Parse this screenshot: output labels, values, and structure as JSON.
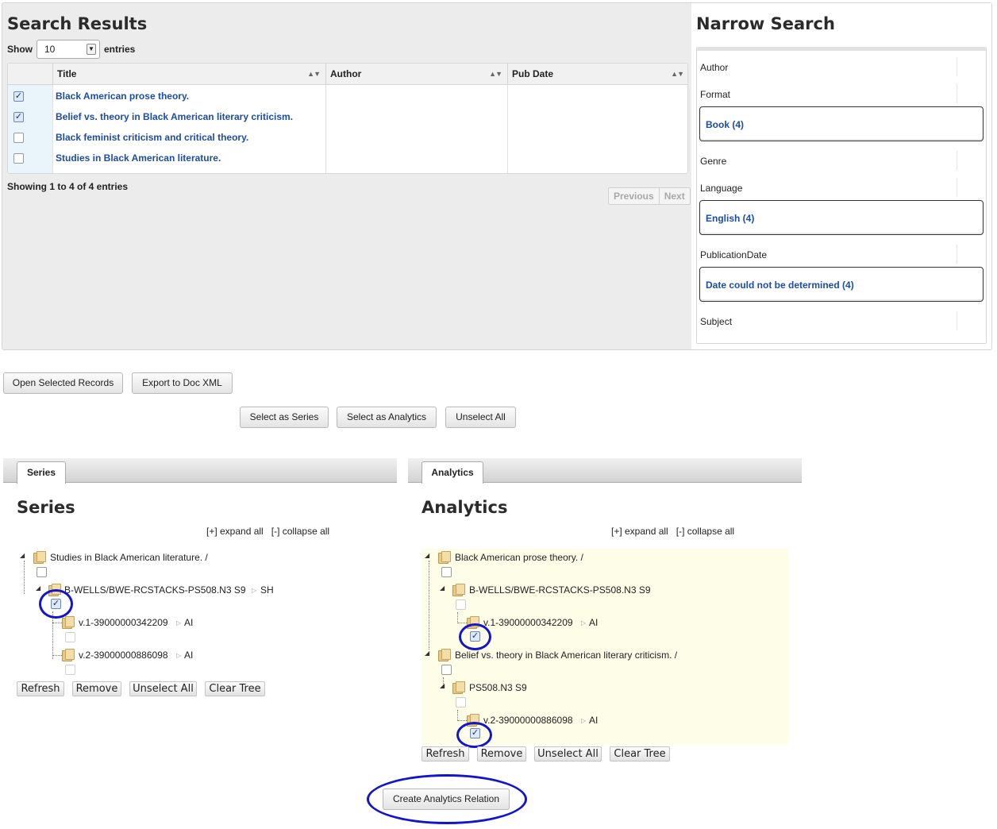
{
  "search_results": {
    "title": "Search Results",
    "show_label": "Show",
    "entries_value": "10",
    "entries_label": "entries",
    "columns": [
      "Title",
      "Author",
      "Pub Date"
    ],
    "rows": [
      {
        "title": "Black American prose theory.",
        "checked": true
      },
      {
        "title": "Belief vs. theory in Black American literary criticism.",
        "checked": true
      },
      {
        "title": "Black feminist criticism and critical theory.",
        "checked": false
      },
      {
        "title": "Studies in Black American literature.",
        "checked": false
      }
    ],
    "showing_text": "Showing 1 to 4 of 4 entries",
    "pager": {
      "previous": "Previous",
      "next": "Next"
    }
  },
  "narrow_search": {
    "title": "Narrow Search",
    "facets": {
      "author": "Author",
      "format": "Format",
      "format_value": "Book (4)",
      "genre": "Genre",
      "language": "Language",
      "language_value": "English (4)",
      "publication_date": "PublicationDate",
      "publication_date_value": "Date could not be determined (4)",
      "subject": "Subject"
    }
  },
  "actions": {
    "open_selected": "Open Selected Records",
    "export_doc_xml": "Export to Doc XML",
    "select_as_series": "Select as Series",
    "select_as_analytics": "Select as Analytics",
    "unselect_all": "Unselect All",
    "create_relation": "Create Analytics Relation"
  },
  "series_panel": {
    "tab": "Series",
    "title": "Series",
    "expand_all": "[+] expand all",
    "collapse_all": "[-] collapse all",
    "tree": {
      "root": "Studies in Black American literature. /",
      "holding": "B-WELLS/BWE-RCSTACKS-PS508.N3 S9",
      "holding_tag": "SH",
      "items": [
        {
          "label": "v.1-39000000342209",
          "tag": "AI"
        },
        {
          "label": "v.2-39000000886098",
          "tag": "AI"
        }
      ]
    },
    "buttons": {
      "refresh": "Refresh",
      "remove": "Remove",
      "unselect_all": "Unselect All",
      "clear_tree": "Clear Tree"
    }
  },
  "analytics_panel": {
    "tab": "Analytics",
    "title": "Analytics",
    "expand_all": "[+] expand all",
    "collapse_all": "[-] collapse all",
    "tree": {
      "root1": "Black American prose theory. /",
      "holding1": "B-WELLS/BWE-RCSTACKS-PS508.N3 S9",
      "item1": {
        "label": "v.1-39000000342209",
        "tag": "AI"
      },
      "root2": "Belief vs. theory in Black American literary criticism. /",
      "holding2": "PS508.N3 S9",
      "item2": {
        "label": "v.2-39000000886098",
        "tag": "AI"
      }
    },
    "buttons": {
      "refresh": "Refresh",
      "remove": "Remove",
      "unselect_all": "Unselect All",
      "clear_tree": "Clear Tree"
    }
  },
  "colors": {
    "link": "#1d4da0",
    "annotation_circle": "#1515c8",
    "tree_highlight": "#fdfde8"
  },
  "icons": [
    "checkbox-icon",
    "sort-icon",
    "dropdown-arrow-icon",
    "folder-icon",
    "tree-expand-icon"
  ]
}
